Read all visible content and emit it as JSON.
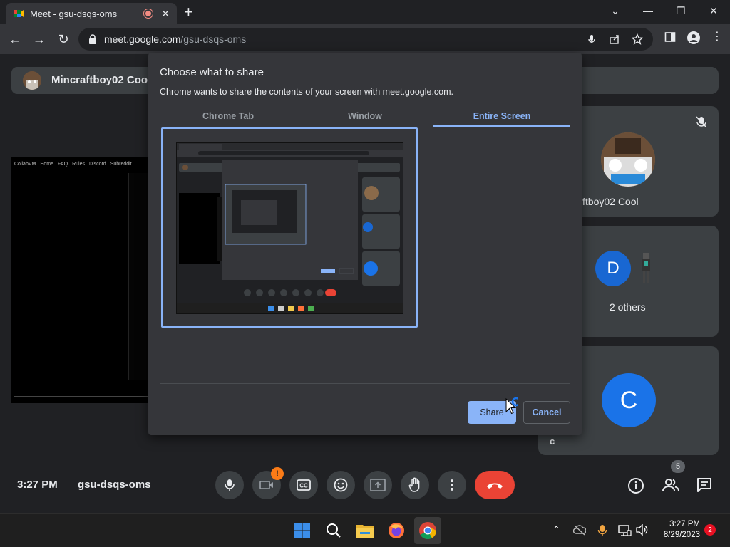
{
  "browser": {
    "tab_title": "Meet - gsu-dsqs-oms",
    "new_tab": "+",
    "url_host": "meet.google.com",
    "url_path": "/gsu-dsqs-oms"
  },
  "meet": {
    "presenter_name": "Mincraftboy02 Cool",
    "tile1_name": "ftboy02 Cool",
    "tile2_avatar_letter": "D",
    "tile2_name": "2 others",
    "tile3_avatar_letter": "C",
    "tile3_name": "c",
    "shared_screen_nav": [
      "CollabVM",
      "Home",
      "FAQ",
      "Rules",
      "Discord",
      "Subreddit"
    ],
    "time": "3:27 PM",
    "meeting_code": "gsu-dsqs-oms",
    "camera_warning": "!",
    "participant_count": "5"
  },
  "dialog": {
    "title": "Choose what to share",
    "subtitle": "Chrome wants to share the contents of your screen with meet.google.com.",
    "tabs": [
      "Chrome Tab",
      "Window",
      "Entire Screen"
    ],
    "active_tab": "Entire Screen",
    "share_label": "Share",
    "cancel_label": "Cancel"
  },
  "taskbar": {
    "time": "3:27 PM",
    "date": "8/29/2023",
    "notifications": "2"
  },
  "colors": {
    "accent": "#8ab4f8",
    "end_call": "#ea4335",
    "warning": "#fa7b17",
    "avatar_blue": "#1a73e8"
  }
}
